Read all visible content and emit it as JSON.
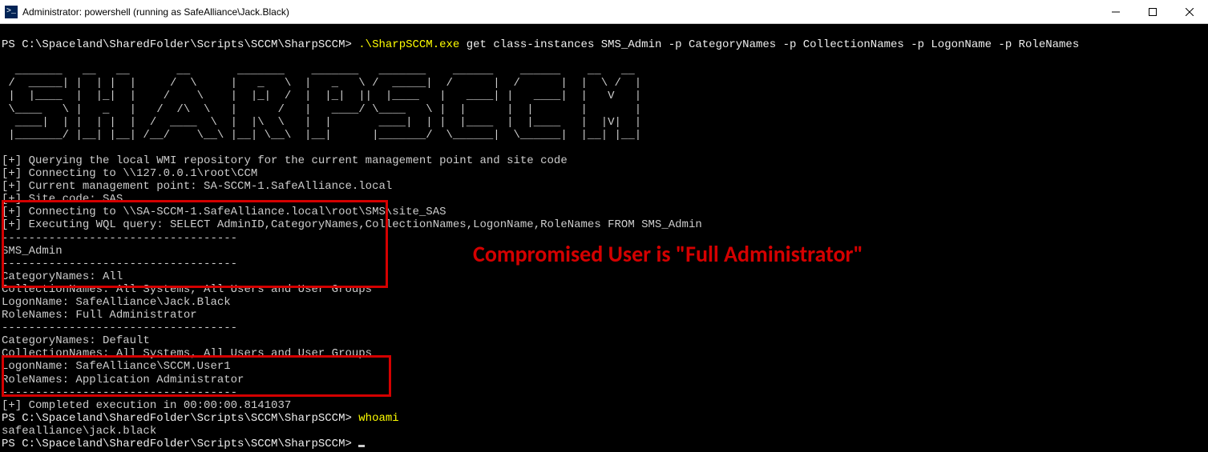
{
  "window": {
    "title": "Administrator: powershell (running as SafeAlliance\\Jack.Black)"
  },
  "prompt1": {
    "path": "PS C:\\Spaceland\\SharedFolder\\Scripts\\SCCM\\SharpSCCM> ",
    "cmd_exe": ".\\SharpSCCM.exe",
    "cmd_rest": " get class-instances SMS_Admin -p CategoryNames -p CollectionNames -p LogonName -p RoleNames"
  },
  "ascii_art": "  _______   __   __       __       _______    _______   _______    ______    ______    __   __  \n /  _____| |  | |  |     /  \\     |   _   \\  |   _   \\ /  _____|  /      |  /      |  |  \\ /  | \n |  |____  |  |_|  |    /    \\    |  |_|  /  |  |_|  ||  |____   |   ____| |   ____|  |   V   | \n \\____   \\ |   _   |   /  /\\  \\   |      /   |   ____/ \\____   \\ |  |      |  |       |       | \n  ____|  | |  | |  |  /  ____  \\  |  |\\  \\   |  |       ____|  | |  |____  |  |____   |  |V|  | \n |_______/ |__| |__| /__/    \\__\\ |__| \\__\\  |__|      |_______/  \\______|  \\______|  |__| |__| ",
  "log_lines": [
    "[+] Querying the local WMI repository for the current management point and site code",
    "[+] Connecting to \\\\127.0.0.1\\root\\CCM",
    "[+] Current management point: SA-SCCM-1.SafeAlliance.local",
    "[+] Site code: SAS",
    "[+] Connecting to \\\\SA-SCCM-1.SafeAlliance.local\\root\\SMS\\site_SAS",
    "[+] Executing WQL query: SELECT AdminID,CategoryNames,CollectionNames,LogonName,RoleNames FROM SMS_Admin"
  ],
  "sep": "-----------------------------------",
  "header": "SMS_Admin",
  "record1": {
    "CategoryNames": "All",
    "CollectionNames": "All Systems, All Users and User Groups",
    "LogonName": "SafeAlliance\\Jack.Black",
    "RoleNames": "Full Administrator"
  },
  "record2": {
    "CategoryNames": "Default",
    "CollectionNames": "All Systems, All Users and User Groups",
    "LogonName": "SafeAlliance\\SCCM.User1",
    "RoleNames": "Application Administrator"
  },
  "completed": "[+] Completed execution in 00:00:00.8141037",
  "prompt2": {
    "path": "PS C:\\Spaceland\\SharedFolder\\Scripts\\SCCM\\SharpSCCM> ",
    "cmd": "whoami"
  },
  "whoami_out": "safealliance\\jack.black",
  "prompt3": {
    "path": "PS C:\\Spaceland\\SharedFolder\\Scripts\\SCCM\\SharpSCCM> "
  },
  "annotation": "Compromised User is \"Full Administrator\""
}
